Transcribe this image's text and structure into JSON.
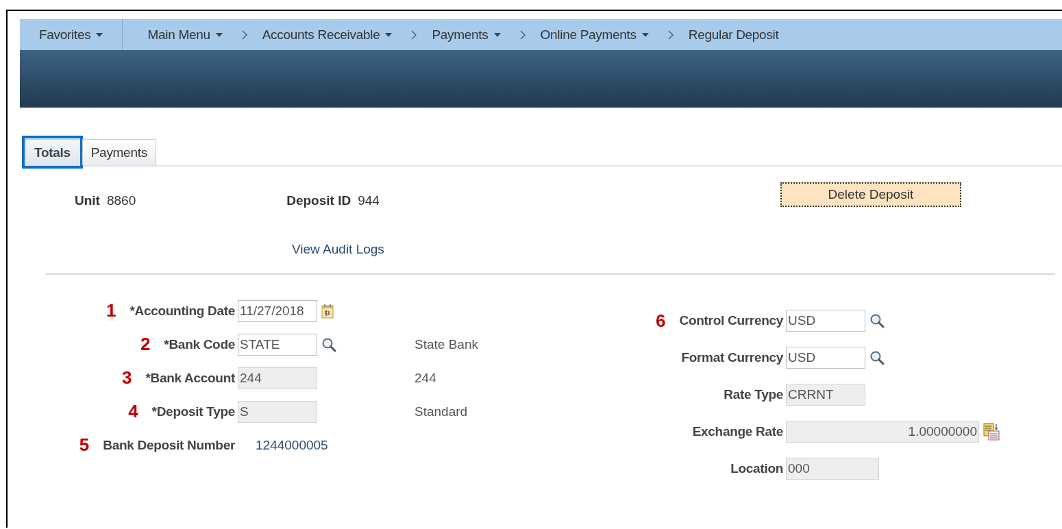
{
  "nav": [
    {
      "label": "Favorites",
      "menu": true,
      "kind": "menu"
    },
    {
      "label": "Main Menu",
      "menu": true,
      "kind": "crumb"
    },
    {
      "label": "Accounts Receivable",
      "menu": true,
      "kind": "crumb"
    },
    {
      "label": "Payments",
      "menu": true,
      "kind": "crumb"
    },
    {
      "label": "Online Payments",
      "menu": true,
      "kind": "crumb"
    },
    {
      "label": "Regular Deposit",
      "menu": false,
      "kind": "crumb"
    }
  ],
  "tabs": [
    {
      "label": "Totals",
      "selected": true,
      "highlighted": true
    },
    {
      "label": "Payments",
      "selected": false,
      "highlighted": false
    }
  ],
  "header": {
    "unit": {
      "label": "Unit",
      "value": "8860"
    },
    "deposit_id": {
      "label": "Deposit ID",
      "value": "944"
    },
    "delete_button": "Delete Deposit",
    "audit_link": "View Audit Logs"
  },
  "left_fields": [
    {
      "marker": "1",
      "label": "*Accounting Date",
      "value": "11/27/2018",
      "kind": "date",
      "readonly": false
    },
    {
      "marker": "2",
      "label": "*Bank Code",
      "value": "STATE",
      "kind": "lookup",
      "readonly": false,
      "description": "State Bank"
    },
    {
      "marker": "3",
      "label": "*Bank Account",
      "value": "244",
      "kind": "text",
      "readonly": true,
      "description": "244"
    },
    {
      "marker": "4",
      "label": "*Deposit Type",
      "value": "S",
      "kind": "text",
      "readonly": true,
      "description": "Standard"
    },
    {
      "marker": "5",
      "label": "Bank Deposit Number",
      "value": "1244000005",
      "kind": "display"
    }
  ],
  "right_fields": [
    {
      "marker": "6",
      "label": "Control Currency",
      "value": "USD",
      "kind": "lookup",
      "readonly": false
    },
    {
      "label": "Format Currency",
      "value": "USD",
      "kind": "lookup",
      "readonly": false
    },
    {
      "label": "Rate Type",
      "value": "CRRNT",
      "kind": "text",
      "readonly": true
    },
    {
      "label": "Exchange Rate",
      "value": "1.00000000",
      "kind": "rate",
      "readonly": true
    },
    {
      "label": "Location",
      "value": "000",
      "kind": "text",
      "readonly": true
    }
  ]
}
